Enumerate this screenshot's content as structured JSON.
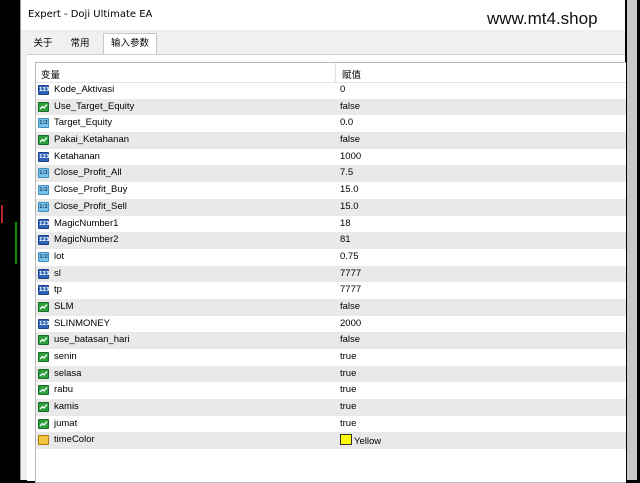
{
  "window": {
    "title": "Expert - Doji Ultimate EA"
  },
  "watermark": "www.mt4.shop",
  "tabs": [
    {
      "label": "关于",
      "active": false
    },
    {
      "label": "常用",
      "active": false
    },
    {
      "label": "输入参数",
      "active": true
    }
  ],
  "table": {
    "headers": {
      "variable": "变量",
      "value": "赋值"
    },
    "rows": [
      {
        "name": "Kode_Aktivasi",
        "value": "0",
        "type": "int"
      },
      {
        "name": "Use_Target_Equity",
        "value": "false",
        "type": "bool"
      },
      {
        "name": "Target_Equity",
        "value": "0.0",
        "type": "double"
      },
      {
        "name": "Pakai_Ketahanan",
        "value": "false",
        "type": "bool"
      },
      {
        "name": "Ketahanan",
        "value": "1000",
        "type": "int"
      },
      {
        "name": "Close_Profit_All",
        "value": "7.5",
        "type": "double"
      },
      {
        "name": "Close_Profit_Buy",
        "value": "15.0",
        "type": "double"
      },
      {
        "name": "Close_Profit_Sell",
        "value": "15.0",
        "type": "double"
      },
      {
        "name": "MagicNumber1",
        "value": "18",
        "type": "int"
      },
      {
        "name": "MagicNumber2",
        "value": "81",
        "type": "int"
      },
      {
        "name": "lot",
        "value": "0.75",
        "type": "double"
      },
      {
        "name": "sl",
        "value": "7777",
        "type": "int"
      },
      {
        "name": "tp",
        "value": "7777",
        "type": "int"
      },
      {
        "name": "SLM",
        "value": "false",
        "type": "bool"
      },
      {
        "name": "SLINMONEY",
        "value": "2000",
        "type": "int"
      },
      {
        "name": "use_batasan_hari",
        "value": "false",
        "type": "bool"
      },
      {
        "name": "senin",
        "value": "true",
        "type": "bool"
      },
      {
        "name": "selasa",
        "value": "true",
        "type": "bool"
      },
      {
        "name": "rabu",
        "value": "true",
        "type": "bool"
      },
      {
        "name": "kamis",
        "value": "true",
        "type": "bool"
      },
      {
        "name": "jumat",
        "value": "true",
        "type": "bool"
      },
      {
        "name": "timeColor",
        "value": "Yellow",
        "type": "color",
        "swatch": "#ffff00"
      }
    ]
  },
  "icons": {
    "int": "integer-type-icon",
    "double": "double-type-icon",
    "bool": "bool-type-icon",
    "color": "color-type-icon"
  }
}
